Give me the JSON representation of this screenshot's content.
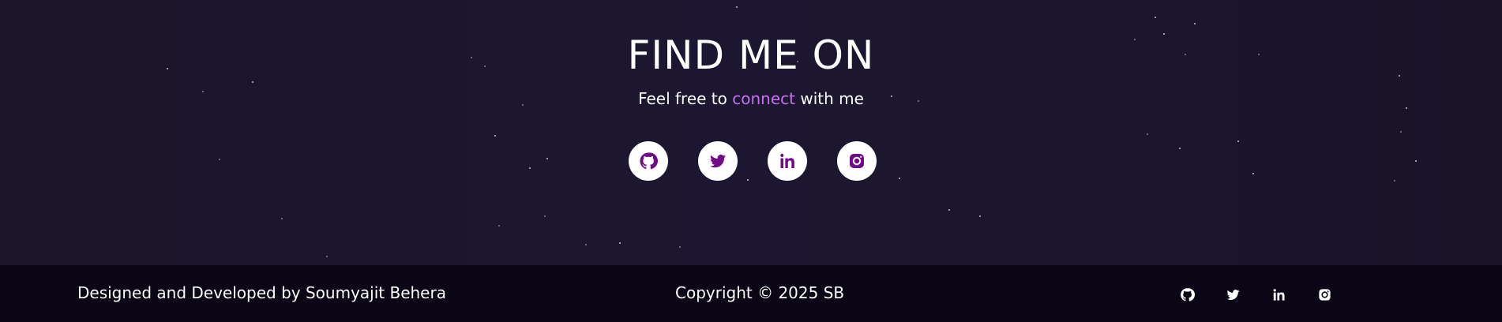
{
  "find_section": {
    "title": "FIND ME ON",
    "subtitle_prefix": "Feel free to ",
    "subtitle_accent": "connect",
    "subtitle_suffix": " with me",
    "accent_color": "#c770f0",
    "icon_color": "#700c86",
    "social_links": [
      {
        "icon": "github-icon"
      },
      {
        "icon": "twitter-icon"
      },
      {
        "icon": "linkedin-icon"
      },
      {
        "icon": "instagram-icon"
      }
    ]
  },
  "footer": {
    "designed_by": "Designed and Developed by Soumyajit Behera",
    "copyright": "Copyright © 2025 SB",
    "social_links": [
      {
        "icon": "github-icon"
      },
      {
        "icon": "twitter-icon"
      },
      {
        "icon": "linkedin-icon"
      },
      {
        "icon": "instagram-icon"
      }
    ]
  }
}
